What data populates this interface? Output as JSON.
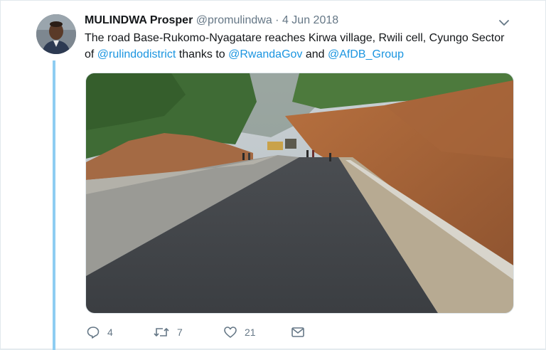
{
  "tweet": {
    "author_name": "MULINDWA Prosper",
    "handle": "@promulindwa",
    "separator": "·",
    "date": "4 Jun 2018",
    "text_segments": {
      "t1": "The road Base-Rukomo-Nyagatare  reaches Kirwa village, Rwili cell, Cyungo Sector of ",
      "m1": "@rulindodistrict",
      "t2": " thanks to ",
      "m2": "@RwandaGov",
      "t3": " and ",
      "m3": "@AfDB_Group"
    },
    "actions": {
      "replies": "4",
      "retweets": "7",
      "likes": "21"
    }
  },
  "icons": {
    "reply": "reply-icon",
    "retweet": "retweet-icon",
    "like": "heart-icon",
    "dm": "envelope-icon",
    "menu": "chevron-down-icon"
  },
  "colors": {
    "link": "#1b95e0",
    "muted": "#657786",
    "thread_line": "#8ecdf2"
  }
}
